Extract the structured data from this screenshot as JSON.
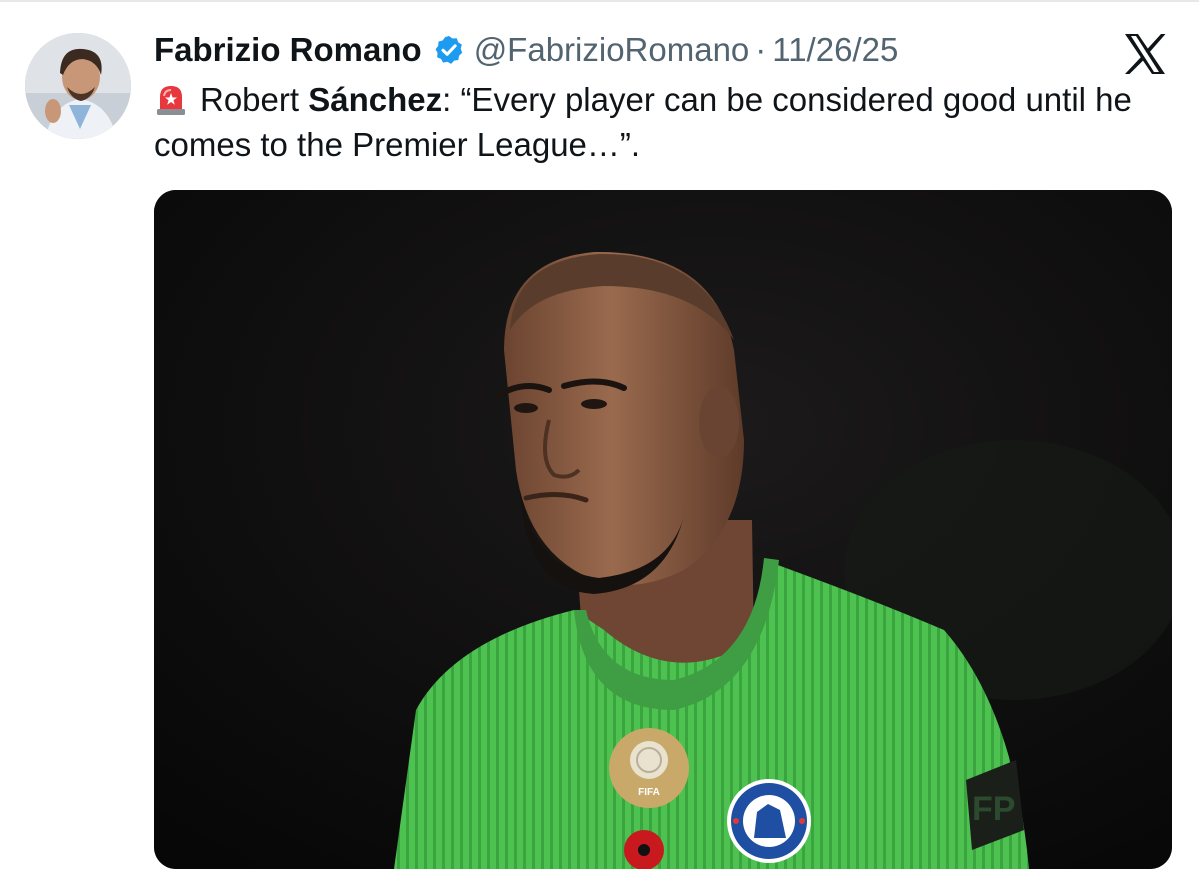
{
  "tweet": {
    "author_name": "Fabrizio Romano",
    "handle": "@FabrizioRomano",
    "separator": "·",
    "date": "11/26/25",
    "verified": true,
    "text_prefix": "Robert ",
    "text_bold": "Sánchez",
    "text_rest": ": “Every player can be considered good until he comes to the Premier League…”."
  },
  "icons": {
    "alert": "rotating-light-emoji-icon",
    "verified": "verified-badge-icon",
    "platform": "x-logo-icon"
  },
  "colors": {
    "text_primary": "#0f1419",
    "text_secondary": "#536471",
    "verified_blue": "#1d9bf0",
    "jersey_green": "#4cc04f",
    "media_background": "#0d0d0d"
  }
}
